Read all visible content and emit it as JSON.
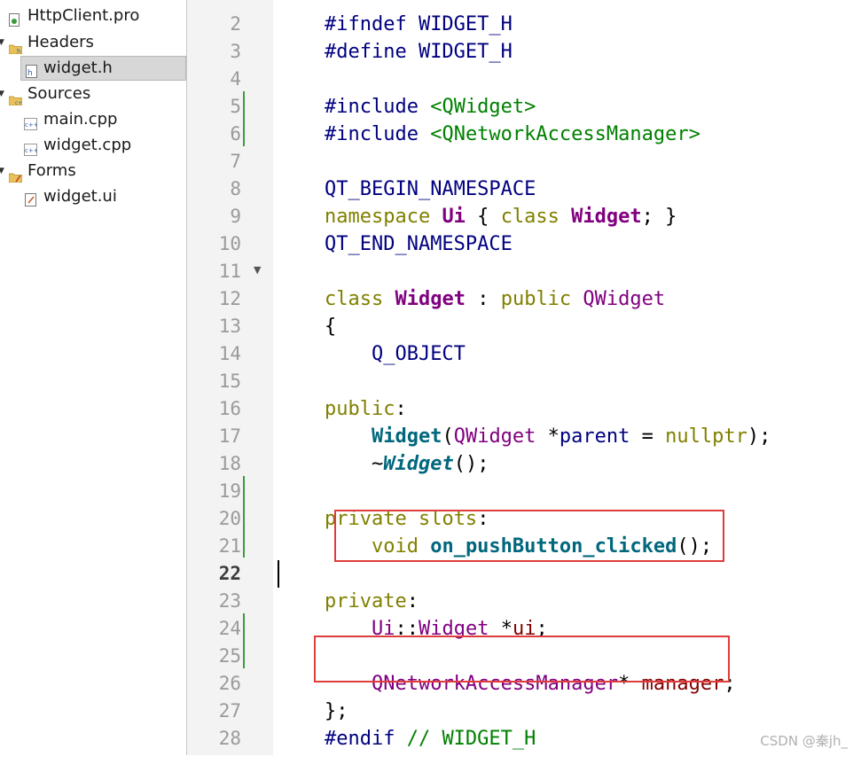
{
  "tree": {
    "items": [
      {
        "label": "HttpClient.pro",
        "icon": "project-file-icon"
      },
      {
        "label": "Headers",
        "icon": "folder-icon"
      },
      {
        "label": "widget.h",
        "icon": "header-file-icon"
      },
      {
        "label": "Sources",
        "icon": "folder-icon"
      },
      {
        "label": "main.cpp",
        "icon": "cpp-file-icon"
      },
      {
        "label": "widget.cpp",
        "icon": "cpp-file-icon"
      },
      {
        "label": "Forms",
        "icon": "folder-icon"
      },
      {
        "label": "widget.ui",
        "icon": "ui-file-icon"
      }
    ]
  },
  "editor": {
    "current_line": 22,
    "line_numbers": [
      "2",
      "3",
      "4",
      "5",
      "6",
      "7",
      "8",
      "9",
      "10",
      "11",
      "12",
      "13",
      "14",
      "15",
      "16",
      "17",
      "18",
      "19",
      "20",
      "21",
      "22",
      "23",
      "24",
      "25",
      "26",
      "27",
      "28"
    ],
    "lines": {
      "l1": "#ifndef WIDGET_H",
      "l2": "#define WIDGET_H",
      "l4a": "#include ",
      "l4b": "<QWidget>",
      "l5a": "#include ",
      "l5b": "<QNetworkAccessManager>",
      "l7": "QT_BEGIN_NAMESPACE",
      "l8a": "namespace ",
      "l8b": "Ui",
      "l8c": " { ",
      "l8d": "class ",
      "l8e": "Widget",
      "l8f": "; }",
      "l9": "QT_END_NAMESPACE",
      "l11a": "class ",
      "l11b": "Widget",
      "l11c": " : ",
      "l11d": "public ",
      "l11e": "QWidget",
      "l12": "{",
      "l13": "    Q_OBJECT",
      "l15a": "public",
      "l15b": ":",
      "l16a": "    ",
      "l16b": "Widget",
      "l16c": "(",
      "l16d": "QWidget",
      "l16e": " *",
      "l16f": "parent",
      "l16g": " = ",
      "l16h": "nullptr",
      "l16i": ");",
      "l17a": "    ~",
      "l17b": "Widget",
      "l17c": "();",
      "l19a": "private ",
      "l19b": "slots",
      "l19c": ":",
      "l20a": "    ",
      "l20b": "void ",
      "l20c": "on_pushButton_clicked",
      "l20d": "();",
      "l22a": "private",
      "l22b": ":",
      "l23a": "    ",
      "l23b": "Ui",
      "l23c": "::",
      "l23d": "Widget",
      "l23e": " *",
      "l23f": "ui",
      "l23g": ";",
      "l25a": "    ",
      "l25b": "QNetworkAccessManager",
      "l25c": "* ",
      "l25d": "manager",
      "l25e": ";",
      "l26": "};",
      "l27a": "#endif ",
      "l27b": "// WIDGET_H"
    }
  },
  "watermark": "CSDN @秦jh_",
  "colors": {
    "keyword": "#808000",
    "type": "#800080",
    "function": "#00677c",
    "string": "#008000",
    "highlight_box": "#e03c3c",
    "change_bar": "#3c9c3c"
  }
}
